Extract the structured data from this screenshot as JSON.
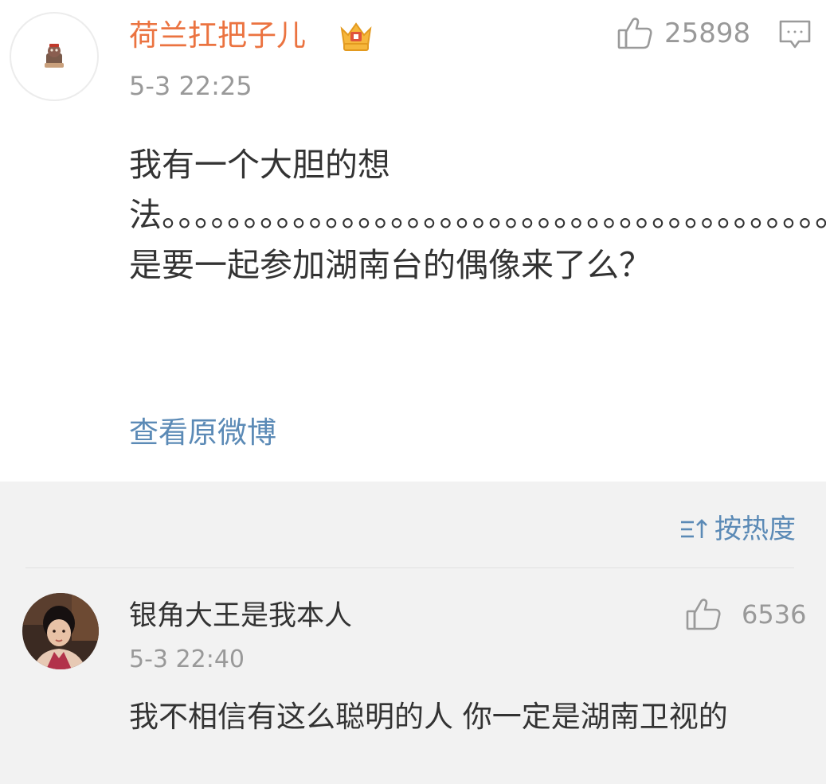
{
  "main_comment": {
    "username": "荷兰扛把子儿",
    "like_count": "25898",
    "timestamp": "5-3 22:25",
    "text": "我有一个大胆的想法。。。。。。。。。。。。。。。。。。。。。。。。。。。。。。。。。。。。。。。。。。。。。。。。。。。是要一起参加湖南台的偶像来了么？",
    "view_original_label": "查看原微博",
    "icons": {
      "avatar": "avatar-icon",
      "vip_badge": "crown-badge-icon",
      "like": "thumbs-up-icon",
      "reply": "comment-icon"
    }
  },
  "sort": {
    "label": "按热度",
    "icon": "sort-icon"
  },
  "replies": [
    {
      "username": "银角大王是我本人",
      "like_count": "6536",
      "timestamp": "5-3 22:40",
      "text": "我不相信有这么聪明的人 你一定是湖南卫视的"
    }
  ],
  "colors": {
    "username_accent": "#eb7340",
    "link_blue": "#5b8ab6",
    "secondary_gray": "#999999",
    "body_text": "#333333",
    "list_background": "#f2f2f2"
  }
}
